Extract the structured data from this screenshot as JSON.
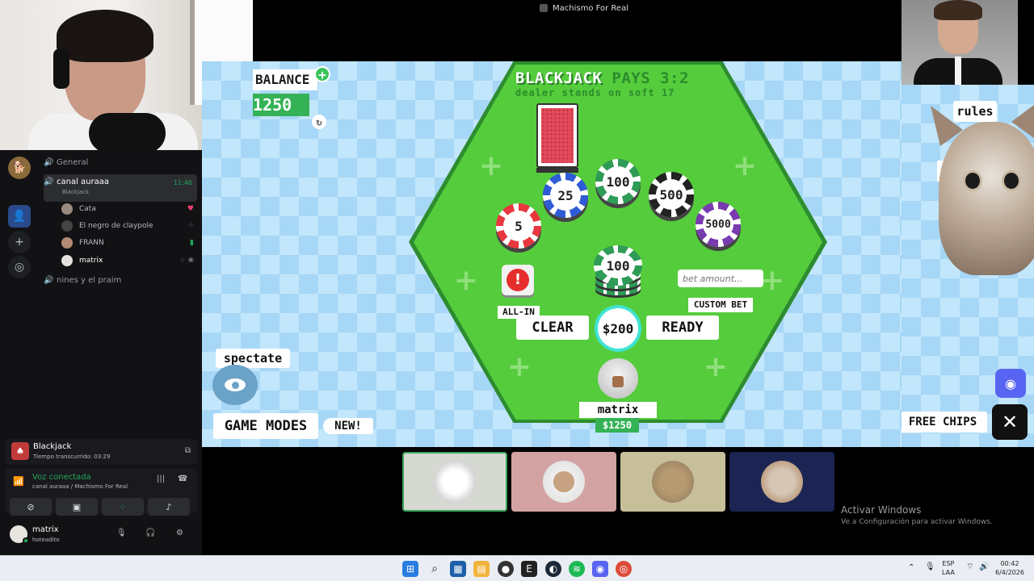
{
  "window": {
    "title": "Machismo For Real"
  },
  "discord": {
    "channels": [
      {
        "name": "General"
      },
      {
        "name": "canal auraaa",
        "sub": "Blackjack",
        "time": "11:46"
      },
      {
        "name": "nines y el praim"
      }
    ],
    "members": [
      {
        "name": "Cata"
      },
      {
        "name": "El negro de claypole"
      },
      {
        "name": "FRANN"
      },
      {
        "name": "matrix"
      }
    ],
    "activity": {
      "title": "Blackjack",
      "elapsed": "Tiempo transcurrido: 03:29"
    },
    "voice": {
      "status": "Voz conectada",
      "location": "canal auraaa / Machismo For Real"
    },
    "user": {
      "name": "matrix",
      "status": "hoteadito"
    }
  },
  "game": {
    "balance": {
      "label": "BALANCE",
      "amount": "1250"
    },
    "title": {
      "main": "BLACKJACK",
      "pays": "PAYS 3:2",
      "sub": "dealer stands on soft 17"
    },
    "chips": [
      {
        "value": "5"
      },
      {
        "value": "25"
      },
      {
        "value": "100"
      },
      {
        "value": "500"
      },
      {
        "value": "5000"
      }
    ],
    "bet_stack_value": "100",
    "all_in_label": "ALL-IN",
    "custom_bet": {
      "placeholder": "bet amount...",
      "label": "CUSTOM BET"
    },
    "clear_label": "CLEAR",
    "ready_label": "READY",
    "bet_total": "$200",
    "player": {
      "name": "matrix",
      "balance": "$1250"
    },
    "spectate_label": "spectate",
    "game_modes_label": "GAME MODES",
    "new_label": "NEW!",
    "rules_label": "rules",
    "re_label": "re",
    "free_chips_label": "FREE CHIPS"
  },
  "windows_watermark": {
    "line1": "Activar Windows",
    "line2": "Ve a Configuración para activar Windows."
  },
  "taskbar": {
    "lang1": "ESP",
    "lang2": "LAA",
    "time": "00:42",
    "date": "6/4/2026"
  }
}
